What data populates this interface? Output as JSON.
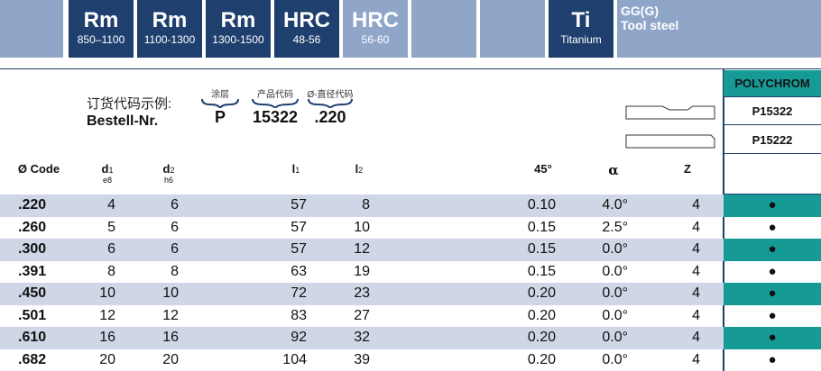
{
  "materials": [
    {
      "big": "Rm",
      "small": "850–1100"
    },
    {
      "big": "Rm",
      "small": "1100-1300"
    },
    {
      "big": "Rm",
      "small": "1300-1500"
    },
    {
      "big": "HRC",
      "small": "48-56"
    },
    {
      "big": "HRC",
      "small": "56-60"
    },
    {
      "big": "Ti",
      "small": "Titanium"
    }
  ],
  "gg_label": "GG(G)",
  "tool_steel_label": "Tool steel",
  "order_example_cn": "订货代码示例:",
  "order_example_de": "Bestell-Nr.",
  "code_parts": [
    {
      "caption": "涂层",
      "value": "P"
    },
    {
      "caption": "产品代码",
      "value": "15322"
    },
    {
      "caption": "Ø-直径代码",
      "value": ".220"
    }
  ],
  "coating": {
    "header": "POLYCHROM",
    "codes": [
      "P15322",
      "P15222"
    ]
  },
  "columns": {
    "code": "Ø Code",
    "d1": "d",
    "d1_sub": "1",
    "d1_tol": "e8",
    "d2": "d",
    "d2_sub": "2",
    "d2_tol": "h6",
    "l1": "l",
    "l1_sub": "1",
    "l2": "l",
    "l2_sub": "2",
    "chamfer": "45°",
    "alpha": "α",
    "z": "Z"
  },
  "rows": [
    {
      "code": ".220",
      "d1": "4",
      "d2": "6",
      "l1": "57",
      "l2": "8",
      "chamfer": "0.10",
      "alpha": "4.0°",
      "z": "4",
      "avail": "●"
    },
    {
      "code": ".260",
      "d1": "5",
      "d2": "6",
      "l1": "57",
      "l2": "10",
      "chamfer": "0.15",
      "alpha": "2.5°",
      "z": "4",
      "avail": "●"
    },
    {
      "code": ".300",
      "d1": "6",
      "d2": "6",
      "l1": "57",
      "l2": "12",
      "chamfer": "0.15",
      "alpha": "0.0°",
      "z": "4",
      "avail": "●"
    },
    {
      "code": ".391",
      "d1": "8",
      "d2": "8",
      "l1": "63",
      "l2": "19",
      "chamfer": "0.15",
      "alpha": "0.0°",
      "z": "4",
      "avail": "●"
    },
    {
      "code": ".450",
      "d1": "10",
      "d2": "10",
      "l1": "72",
      "l2": "23",
      "chamfer": "0.20",
      "alpha": "0.0°",
      "z": "4",
      "avail": "●"
    },
    {
      "code": ".501",
      "d1": "12",
      "d2": "12",
      "l1": "83",
      "l2": "27",
      "chamfer": "0.20",
      "alpha": "0.0°",
      "z": "4",
      "avail": "●"
    },
    {
      "code": ".610",
      "d1": "16",
      "d2": "16",
      "l1": "92",
      "l2": "32",
      "chamfer": "0.20",
      "alpha": "0.0°",
      "z": "4",
      "avail": "●"
    },
    {
      "code": ".682",
      "d1": "20",
      "d2": "20",
      "l1": "104",
      "l2": "39",
      "chamfer": "0.20",
      "alpha": "0.0°",
      "z": "4",
      "avail": "●"
    }
  ],
  "colors": {
    "navy": "#1f3f6e",
    "light_blue": "#8fa6c9",
    "teal": "#159a96",
    "row_shade": "#cfd6e6"
  }
}
